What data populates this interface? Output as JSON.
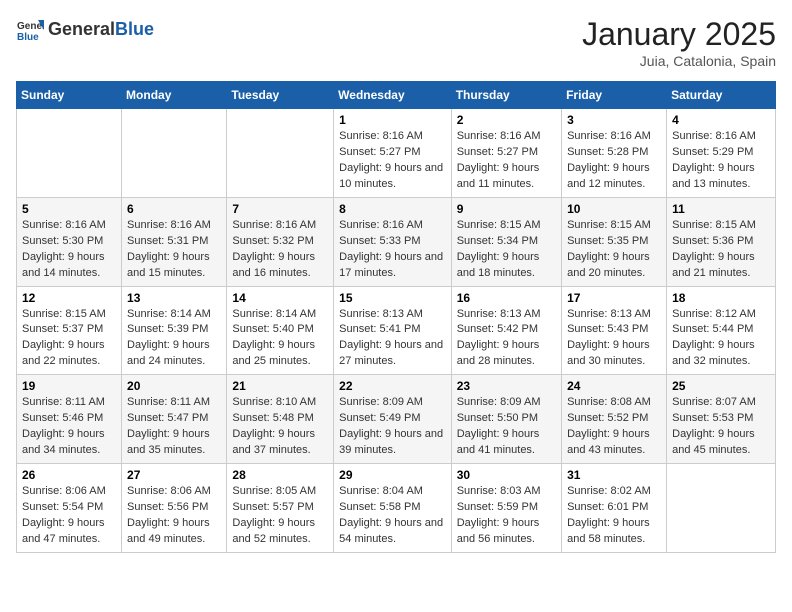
{
  "header": {
    "logo": {
      "general": "General",
      "blue": "Blue"
    },
    "title": "January 2025",
    "location": "Juia, Catalonia, Spain"
  },
  "weekdays": [
    "Sunday",
    "Monday",
    "Tuesday",
    "Wednesday",
    "Thursday",
    "Friday",
    "Saturday"
  ],
  "weeks": [
    [
      null,
      null,
      null,
      {
        "day": 1,
        "sunrise": "8:16 AM",
        "sunset": "5:27 PM",
        "daylight": "9 hours and 10 minutes."
      },
      {
        "day": 2,
        "sunrise": "8:16 AM",
        "sunset": "5:27 PM",
        "daylight": "9 hours and 11 minutes."
      },
      {
        "day": 3,
        "sunrise": "8:16 AM",
        "sunset": "5:28 PM",
        "daylight": "9 hours and 12 minutes."
      },
      {
        "day": 4,
        "sunrise": "8:16 AM",
        "sunset": "5:29 PM",
        "daylight": "9 hours and 13 minutes."
      }
    ],
    [
      {
        "day": 5,
        "sunrise": "8:16 AM",
        "sunset": "5:30 PM",
        "daylight": "9 hours and 14 minutes."
      },
      {
        "day": 6,
        "sunrise": "8:16 AM",
        "sunset": "5:31 PM",
        "daylight": "9 hours and 15 minutes."
      },
      {
        "day": 7,
        "sunrise": "8:16 AM",
        "sunset": "5:32 PM",
        "daylight": "9 hours and 16 minutes."
      },
      {
        "day": 8,
        "sunrise": "8:16 AM",
        "sunset": "5:33 PM",
        "daylight": "9 hours and 17 minutes."
      },
      {
        "day": 9,
        "sunrise": "8:15 AM",
        "sunset": "5:34 PM",
        "daylight": "9 hours and 18 minutes."
      },
      {
        "day": 10,
        "sunrise": "8:15 AM",
        "sunset": "5:35 PM",
        "daylight": "9 hours and 20 minutes."
      },
      {
        "day": 11,
        "sunrise": "8:15 AM",
        "sunset": "5:36 PM",
        "daylight": "9 hours and 21 minutes."
      }
    ],
    [
      {
        "day": 12,
        "sunrise": "8:15 AM",
        "sunset": "5:37 PM",
        "daylight": "9 hours and 22 minutes."
      },
      {
        "day": 13,
        "sunrise": "8:14 AM",
        "sunset": "5:39 PM",
        "daylight": "9 hours and 24 minutes."
      },
      {
        "day": 14,
        "sunrise": "8:14 AM",
        "sunset": "5:40 PM",
        "daylight": "9 hours and 25 minutes."
      },
      {
        "day": 15,
        "sunrise": "8:13 AM",
        "sunset": "5:41 PM",
        "daylight": "9 hours and 27 minutes."
      },
      {
        "day": 16,
        "sunrise": "8:13 AM",
        "sunset": "5:42 PM",
        "daylight": "9 hours and 28 minutes."
      },
      {
        "day": 17,
        "sunrise": "8:13 AM",
        "sunset": "5:43 PM",
        "daylight": "9 hours and 30 minutes."
      },
      {
        "day": 18,
        "sunrise": "8:12 AM",
        "sunset": "5:44 PM",
        "daylight": "9 hours and 32 minutes."
      }
    ],
    [
      {
        "day": 19,
        "sunrise": "8:11 AM",
        "sunset": "5:46 PM",
        "daylight": "9 hours and 34 minutes."
      },
      {
        "day": 20,
        "sunrise": "8:11 AM",
        "sunset": "5:47 PM",
        "daylight": "9 hours and 35 minutes."
      },
      {
        "day": 21,
        "sunrise": "8:10 AM",
        "sunset": "5:48 PM",
        "daylight": "9 hours and 37 minutes."
      },
      {
        "day": 22,
        "sunrise": "8:09 AM",
        "sunset": "5:49 PM",
        "daylight": "9 hours and 39 minutes."
      },
      {
        "day": 23,
        "sunrise": "8:09 AM",
        "sunset": "5:50 PM",
        "daylight": "9 hours and 41 minutes."
      },
      {
        "day": 24,
        "sunrise": "8:08 AM",
        "sunset": "5:52 PM",
        "daylight": "9 hours and 43 minutes."
      },
      {
        "day": 25,
        "sunrise": "8:07 AM",
        "sunset": "5:53 PM",
        "daylight": "9 hours and 45 minutes."
      }
    ],
    [
      {
        "day": 26,
        "sunrise": "8:06 AM",
        "sunset": "5:54 PM",
        "daylight": "9 hours and 47 minutes."
      },
      {
        "day": 27,
        "sunrise": "8:06 AM",
        "sunset": "5:56 PM",
        "daylight": "9 hours and 49 minutes."
      },
      {
        "day": 28,
        "sunrise": "8:05 AM",
        "sunset": "5:57 PM",
        "daylight": "9 hours and 52 minutes."
      },
      {
        "day": 29,
        "sunrise": "8:04 AM",
        "sunset": "5:58 PM",
        "daylight": "9 hours and 54 minutes."
      },
      {
        "day": 30,
        "sunrise": "8:03 AM",
        "sunset": "5:59 PM",
        "daylight": "9 hours and 56 minutes."
      },
      {
        "day": 31,
        "sunrise": "8:02 AM",
        "sunset": "6:01 PM",
        "daylight": "9 hours and 58 minutes."
      },
      null
    ]
  ]
}
